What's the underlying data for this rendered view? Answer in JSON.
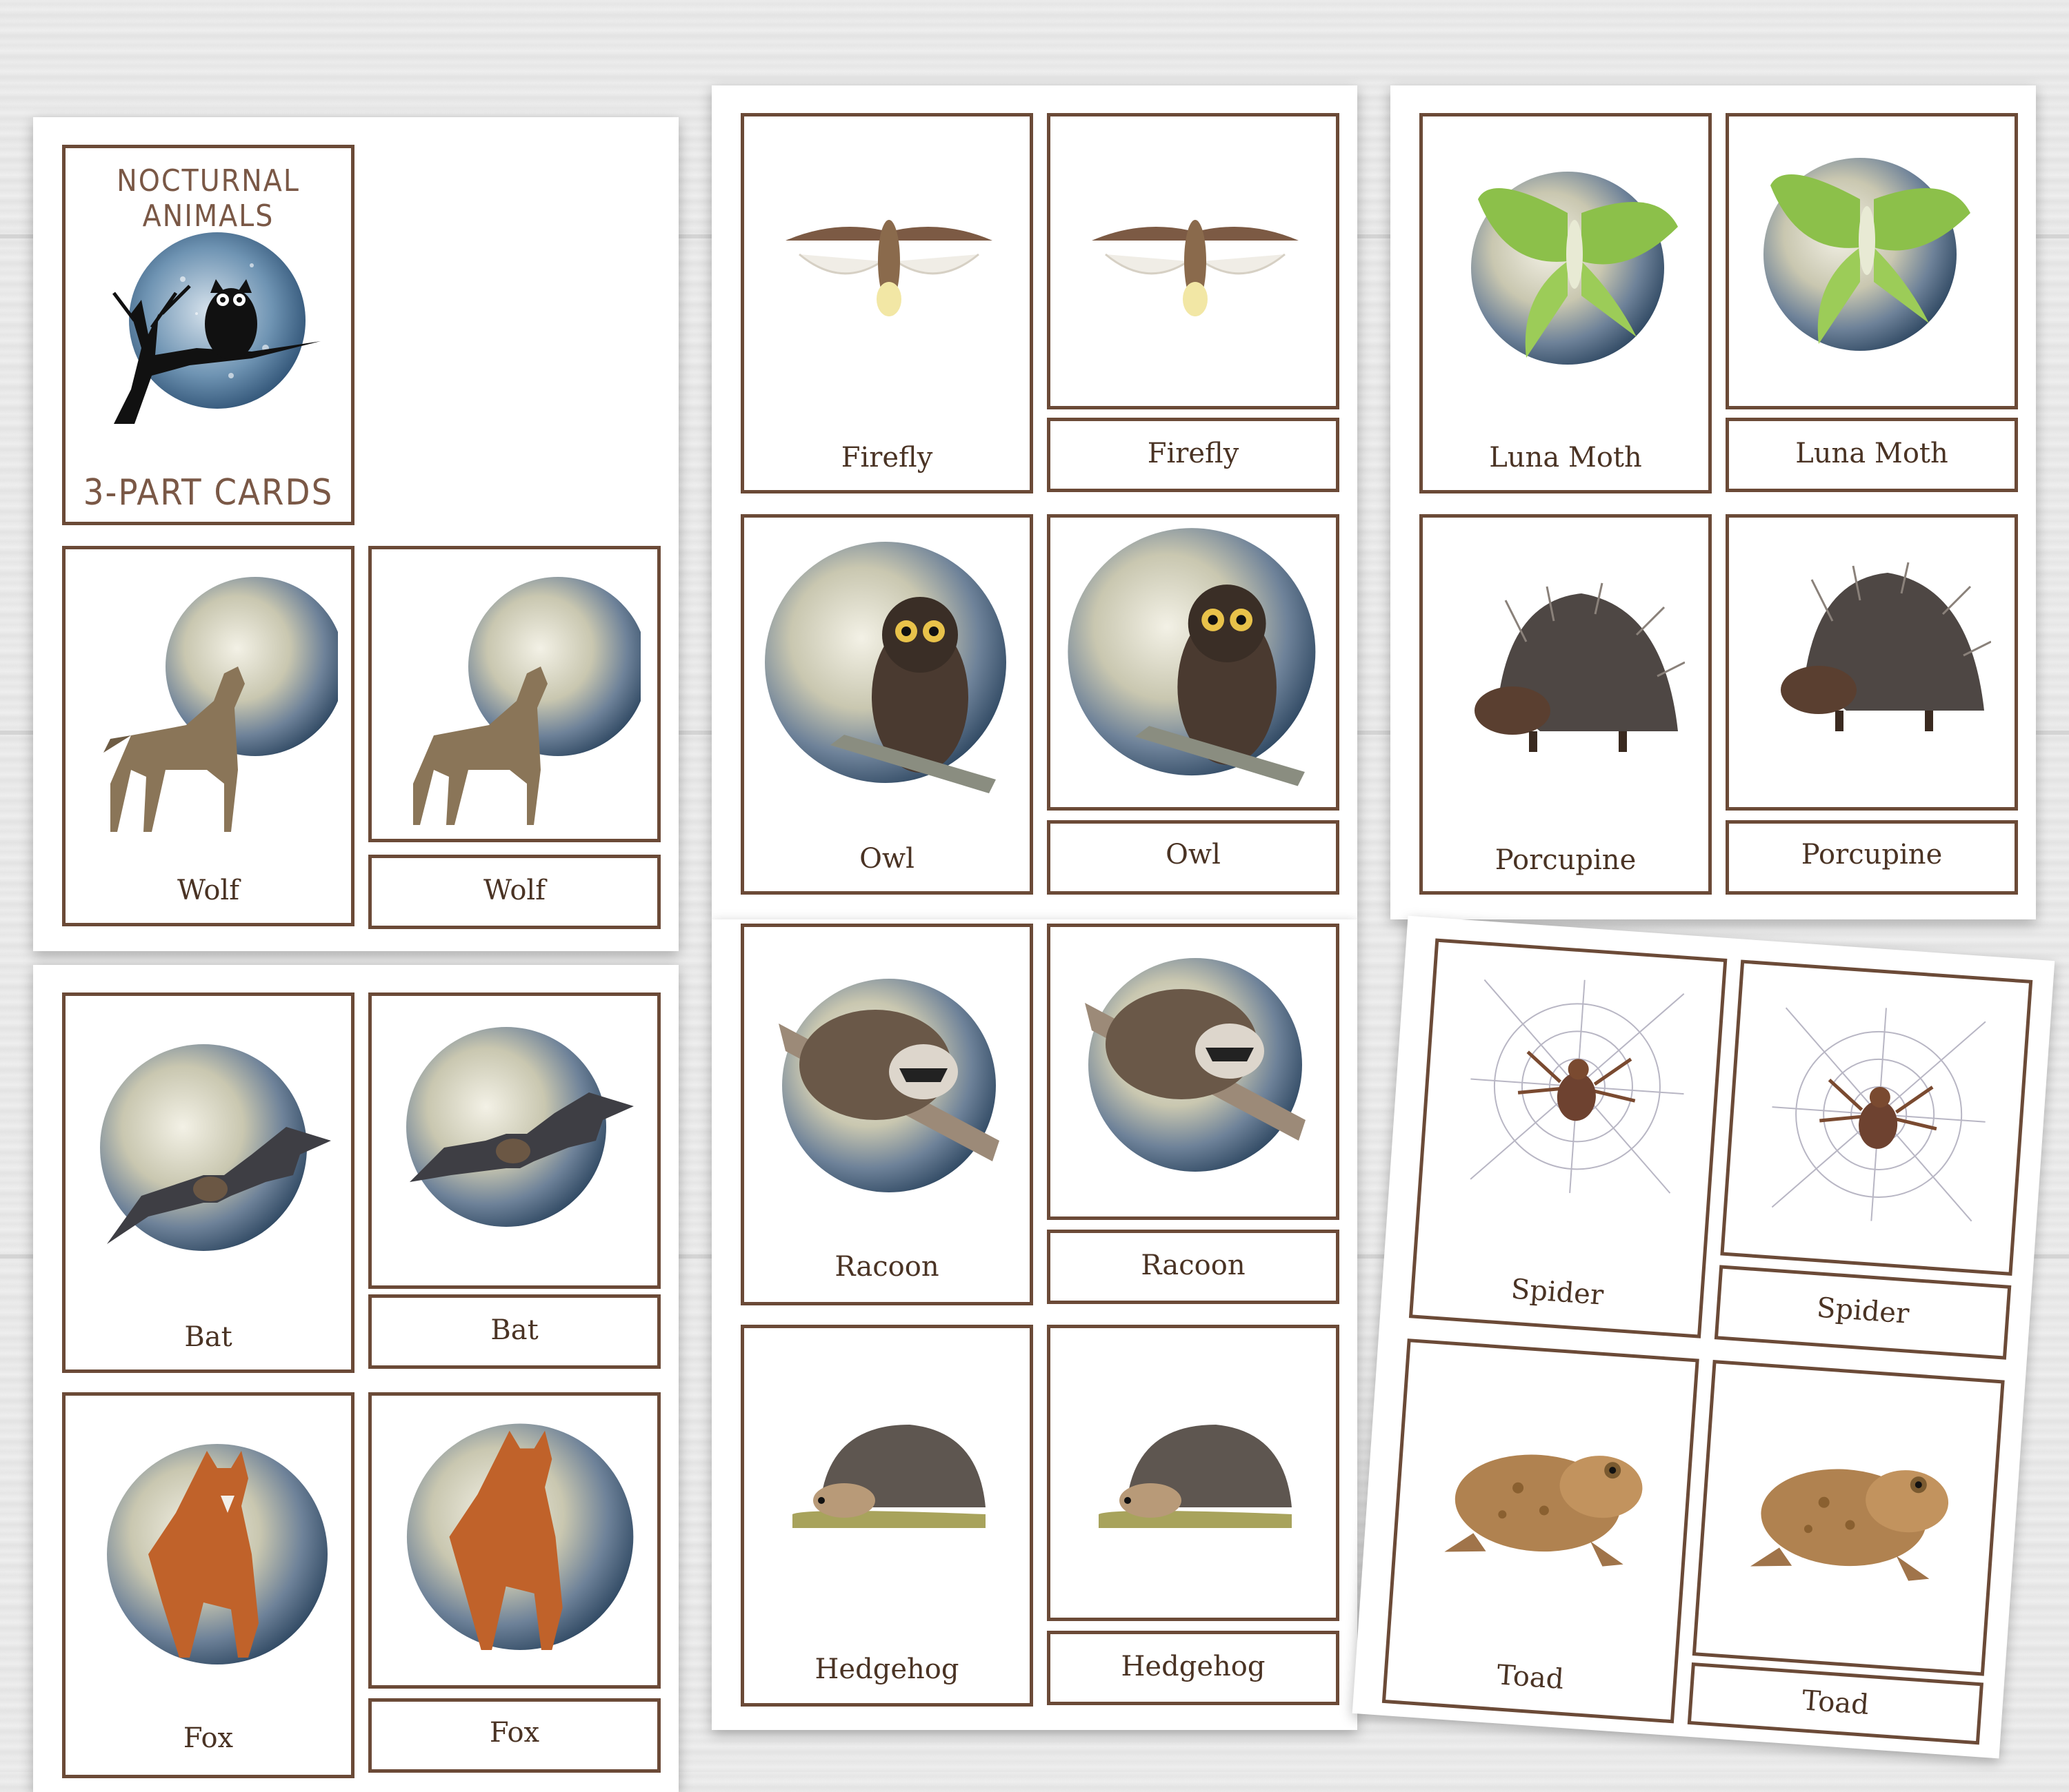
{
  "cover": {
    "title": "NOCTURNAL ANIMALS",
    "subtitle": "3-PART CARDS"
  },
  "sheets": [
    {
      "cards": [
        {
          "label": "Wolf"
        },
        {
          "label": "Wolf"
        }
      ]
    },
    {
      "cards": [
        {
          "label": "Bat"
        },
        {
          "label": "Bat"
        },
        {
          "label": "Fox"
        },
        {
          "label": "Fox"
        }
      ]
    },
    {
      "cards": [
        {
          "label": "Firefly"
        },
        {
          "label": "Firefly"
        },
        {
          "label": "Owl"
        },
        {
          "label": "Owl"
        }
      ]
    },
    {
      "cards": [
        {
          "label": "Racoon"
        },
        {
          "label": "Racoon"
        },
        {
          "label": "Hedgehog"
        },
        {
          "label": "Hedgehog"
        }
      ]
    },
    {
      "cards": [
        {
          "label": "Luna Moth"
        },
        {
          "label": "Luna Moth"
        },
        {
          "label": "Porcupine"
        },
        {
          "label": "Porcupine"
        }
      ]
    },
    {
      "cards": [
        {
          "label": "Spider"
        },
        {
          "label": "Spider"
        },
        {
          "label": "Toad"
        },
        {
          "label": "Toad"
        }
      ]
    }
  ],
  "colors": {
    "border": "#6b4a37",
    "text": "#4a3324",
    "moon": "#4f6a85"
  }
}
